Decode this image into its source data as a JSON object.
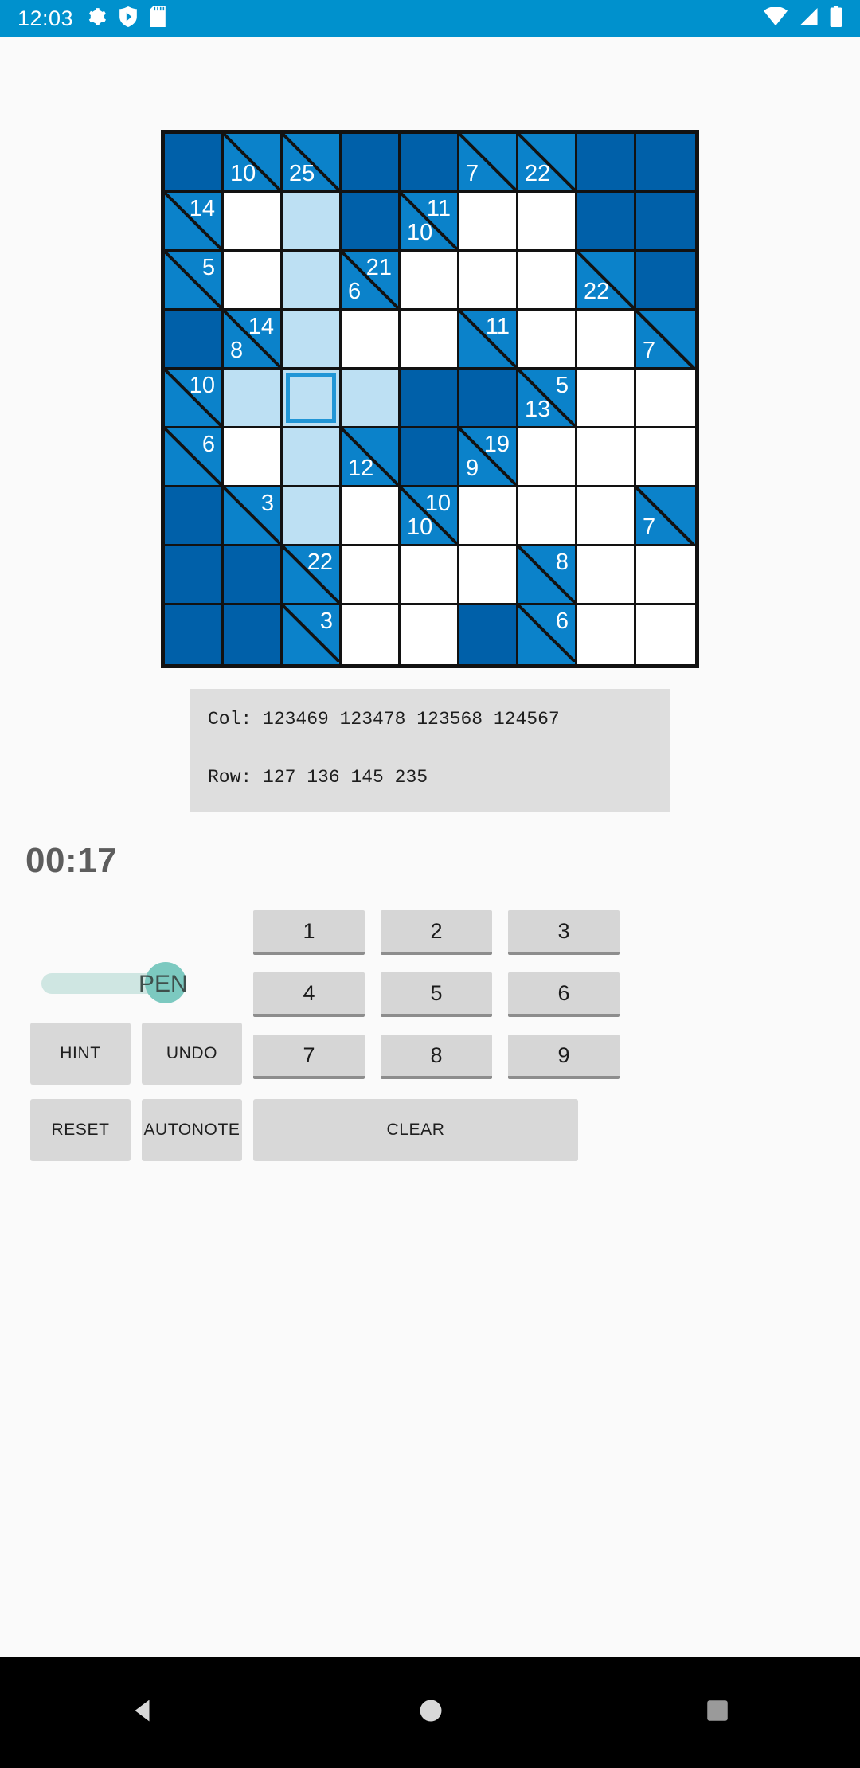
{
  "status_bar": {
    "clock": "12:03",
    "left_icons": [
      "gear-icon",
      "play-shield-icon",
      "sdcard-icon"
    ],
    "right_icons": [
      "wifi-icon",
      "signal-icon",
      "battery-icon"
    ],
    "background": "#0091cd"
  },
  "board": {
    "rows": 9,
    "cols": 9,
    "colors": {
      "block": "#0060a9",
      "clue": "#0b82ca",
      "empty": "#ffffff",
      "highlight": "#bde0f3",
      "selection_border": "#2196d6",
      "grid_line": "#121212"
    },
    "cells": [
      [
        {
          "t": "block"
        },
        {
          "t": "clue",
          "down": "10"
        },
        {
          "t": "clue",
          "down": "25"
        },
        {
          "t": "block"
        },
        {
          "t": "block"
        },
        {
          "t": "clue",
          "down": "7"
        },
        {
          "t": "clue",
          "down": "22"
        },
        {
          "t": "block"
        },
        {
          "t": "block"
        }
      ],
      [
        {
          "t": "clue",
          "across": "14"
        },
        {
          "t": "empty"
        },
        {
          "t": "hl"
        },
        {
          "t": "block"
        },
        {
          "t": "clue",
          "across": "11",
          "down": "10"
        },
        {
          "t": "empty"
        },
        {
          "t": "empty"
        },
        {
          "t": "block"
        },
        {
          "t": "block"
        }
      ],
      [
        {
          "t": "clue",
          "across": "5"
        },
        {
          "t": "empty"
        },
        {
          "t": "hl"
        },
        {
          "t": "clue",
          "across": "21",
          "down": "6"
        },
        {
          "t": "empty"
        },
        {
          "t": "empty"
        },
        {
          "t": "empty"
        },
        {
          "t": "clue",
          "down": "22"
        },
        {
          "t": "block"
        }
      ],
      [
        {
          "t": "block"
        },
        {
          "t": "clue",
          "across": "14",
          "down": "8"
        },
        {
          "t": "hl"
        },
        {
          "t": "empty"
        },
        {
          "t": "empty"
        },
        {
          "t": "clue",
          "across": "11"
        },
        {
          "t": "empty"
        },
        {
          "t": "empty"
        },
        {
          "t": "clue",
          "down": "7"
        }
      ],
      [
        {
          "t": "clue",
          "across": "10"
        },
        {
          "t": "hl"
        },
        {
          "t": "sel"
        },
        {
          "t": "hl"
        },
        {
          "t": "block"
        },
        {
          "t": "block"
        },
        {
          "t": "clue",
          "across": "5",
          "down": "13"
        },
        {
          "t": "empty"
        },
        {
          "t": "empty"
        }
      ],
      [
        {
          "t": "clue",
          "across": "6"
        },
        {
          "t": "empty"
        },
        {
          "t": "hl"
        },
        {
          "t": "clue",
          "down": "12"
        },
        {
          "t": "block"
        },
        {
          "t": "clue",
          "across": "19",
          "down": "9"
        },
        {
          "t": "empty"
        },
        {
          "t": "empty"
        },
        {
          "t": "empty"
        }
      ],
      [
        {
          "t": "block"
        },
        {
          "t": "clue",
          "across": "3"
        },
        {
          "t": "hl"
        },
        {
          "t": "empty"
        },
        {
          "t": "clue",
          "across": "10",
          "down": "10"
        },
        {
          "t": "empty"
        },
        {
          "t": "empty"
        },
        {
          "t": "empty"
        },
        {
          "t": "clue",
          "down": "7"
        }
      ],
      [
        {
          "t": "block"
        },
        {
          "t": "block"
        },
        {
          "t": "clue",
          "across": "22"
        },
        {
          "t": "empty"
        },
        {
          "t": "empty"
        },
        {
          "t": "empty"
        },
        {
          "t": "clue",
          "across": "8"
        },
        {
          "t": "empty"
        },
        {
          "t": "empty"
        }
      ],
      [
        {
          "t": "block"
        },
        {
          "t": "block"
        },
        {
          "t": "clue",
          "across": "3"
        },
        {
          "t": "empty"
        },
        {
          "t": "empty"
        },
        {
          "t": "block"
        },
        {
          "t": "clue",
          "across": "6"
        },
        {
          "t": "empty"
        },
        {
          "t": "empty"
        }
      ]
    ]
  },
  "info_panel": {
    "col_line": "Col:  123469  123478  123568  124567",
    "row_line": "Row: 127  136  145  235"
  },
  "timer": {
    "value": "00:17"
  },
  "pen_toggle": {
    "label": "PEN",
    "state": "on"
  },
  "numpad": {
    "buttons": [
      "1",
      "2",
      "3",
      "4",
      "5",
      "6",
      "7",
      "8",
      "9"
    ]
  },
  "actions": {
    "hint": "HINT",
    "undo": "UNDO",
    "reset": "RESET",
    "auto_note": "AUTO\nNOTE",
    "auto_note_line1": "AUTO",
    "auto_note_line2": "NOTE",
    "clear": "CLEAR"
  },
  "nav_bar": {
    "back": "back-triangle-icon",
    "home": "home-circle-icon",
    "recents": "recents-square-icon"
  }
}
